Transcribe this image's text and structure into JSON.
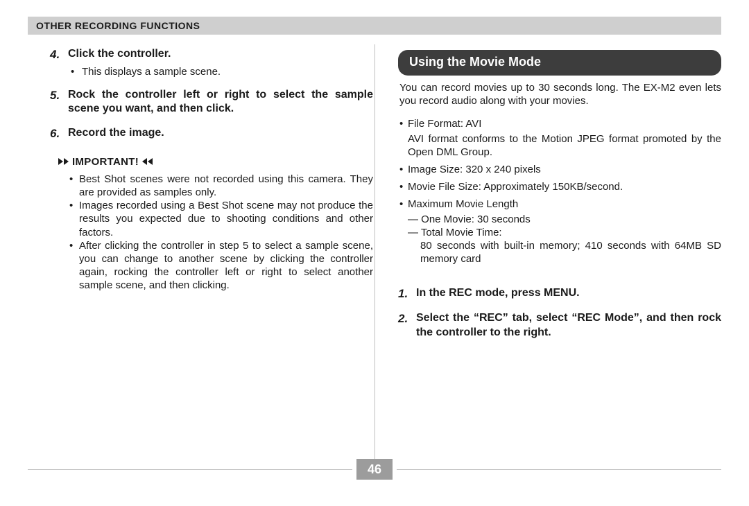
{
  "header": "Other Recording Functions",
  "left": {
    "steps": [
      {
        "num": "4.",
        "text": "Click the controller.",
        "bullets": [
          "This displays a sample scene."
        ]
      },
      {
        "num": "5.",
        "text": "Rock the controller left or right to select the sample scene you want, and then click."
      },
      {
        "num": "6.",
        "text": "Record the image."
      }
    ],
    "important_label": "IMPORTANT!",
    "notes": [
      "Best Shot scenes were not recorded using this camera. They are provided as samples only.",
      "Images recorded using a Best Shot scene may not produce the results you expected due to shooting conditions and other factors.",
      "After clicking the controller in step 5 to select a sample scene, you can change to another scene by clicking the controller again, rocking the controller left or right to select another sample scene, and then clicking."
    ]
  },
  "right": {
    "section_title": "Using the Movie Mode",
    "intro": "You can record movies up to 30 seconds long. The EX-M2 even lets you record audio along with your movies.",
    "specs": [
      {
        "line": "File Format: AVI",
        "sub": [
          "AVI format conforms to the Motion JPEG format promoted by the Open DML Group."
        ]
      },
      {
        "line": "Image Size: 320 x 240 pixels"
      },
      {
        "line": "Movie File Size: Approximately 150KB/second."
      },
      {
        "line": "Maximum Movie Length",
        "sub": [
          "— One Movie: 30 seconds",
          "— Total Movie Time:",
          "80 seconds with built-in memory; 410 seconds with 64MB SD memory card"
        ]
      }
    ],
    "steps": [
      {
        "num": "1.",
        "text": "In the REC mode, press MENU."
      },
      {
        "num": "2.",
        "text": "Select the “REC” tab, select “REC Mode”, and then rock the controller to the right."
      }
    ]
  },
  "page_number": "46"
}
